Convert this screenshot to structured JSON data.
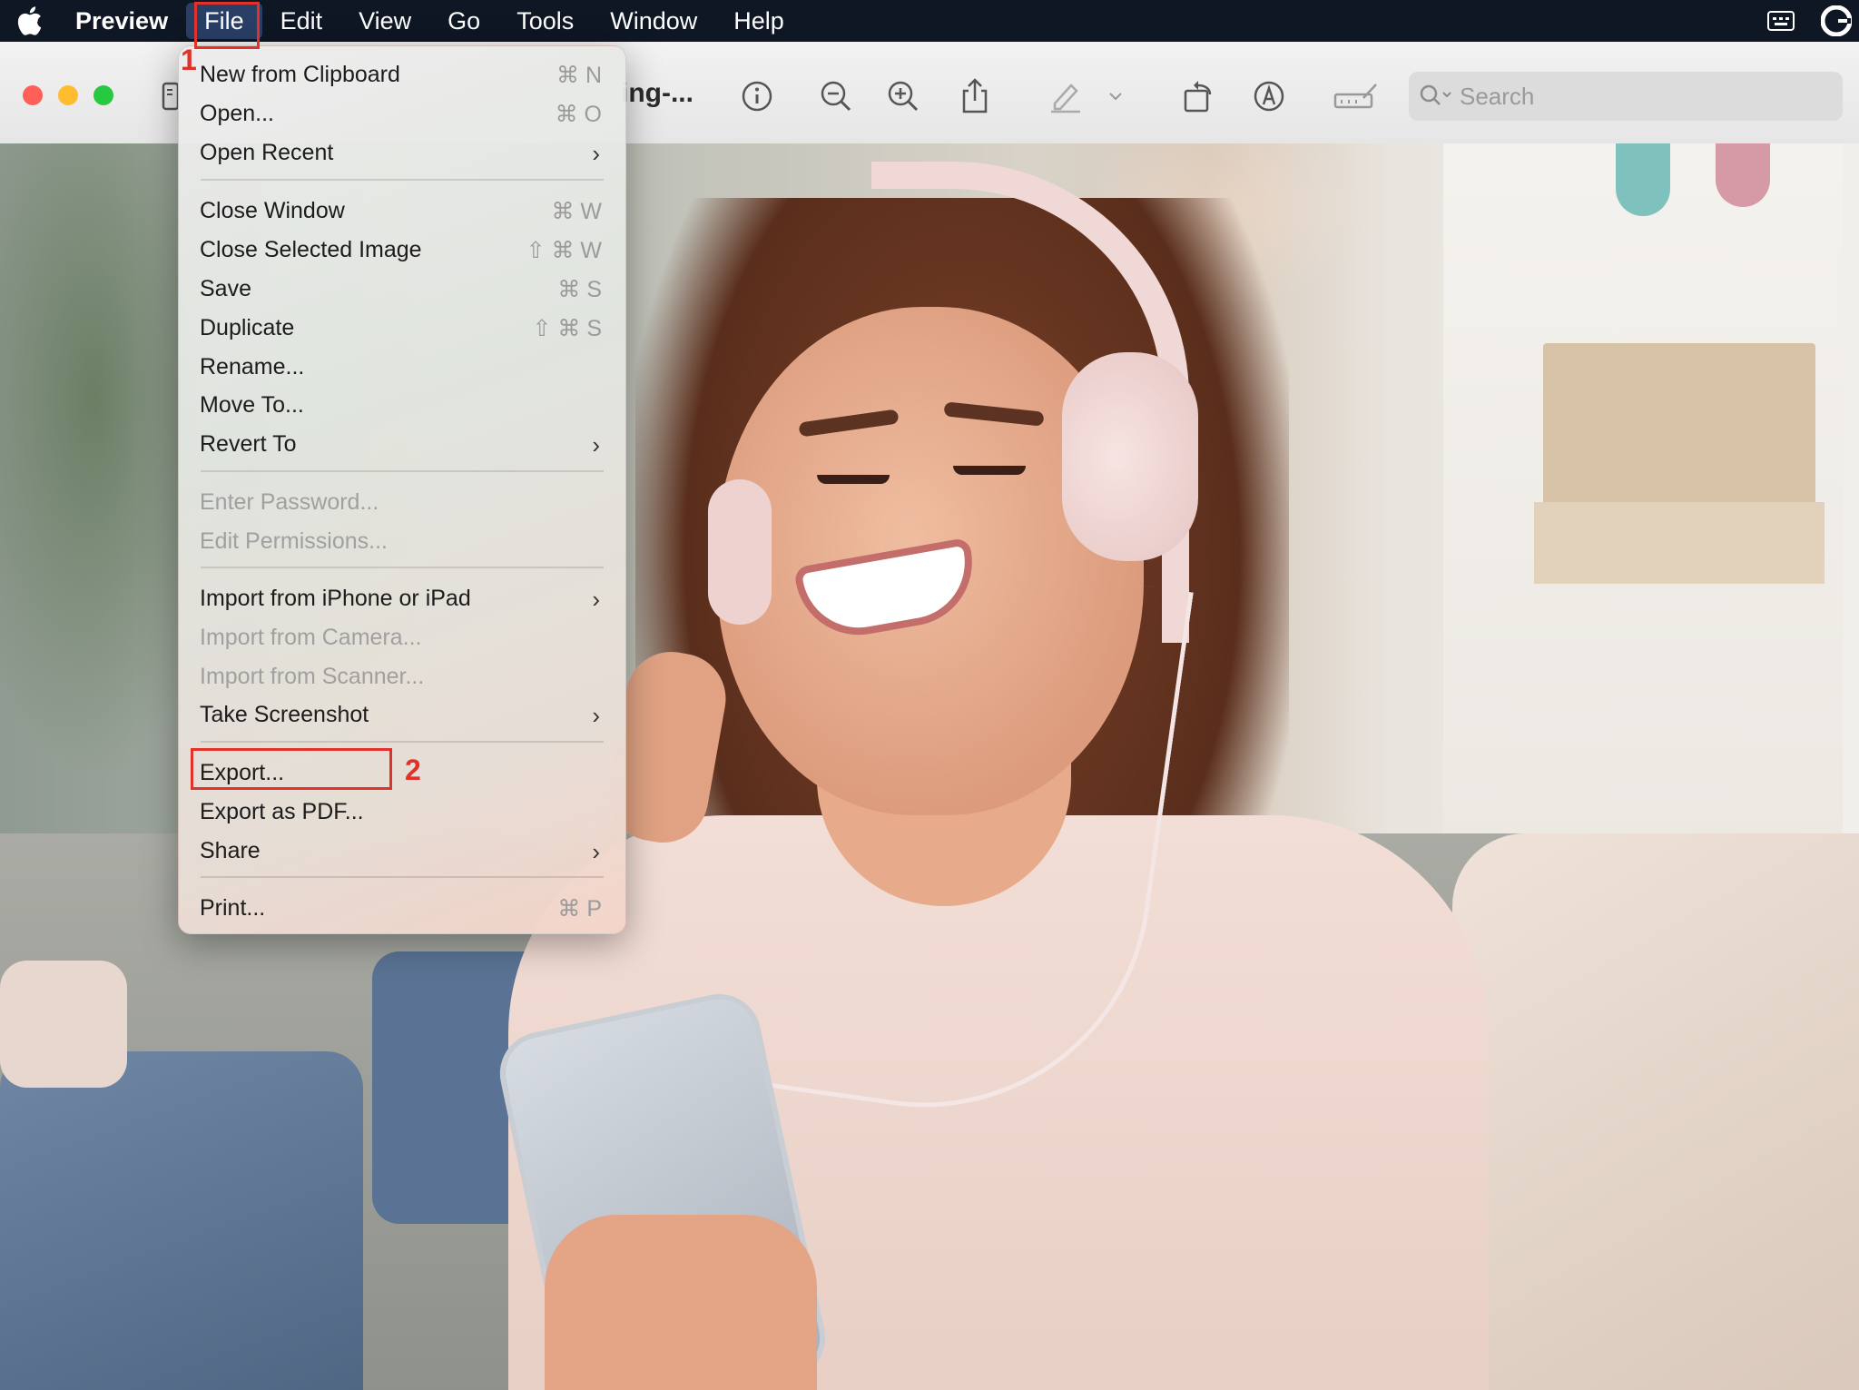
{
  "menubar": {
    "app_name": "Preview",
    "items": [
      "File",
      "Edit",
      "View",
      "Go",
      "Tools",
      "Window",
      "Help"
    ],
    "open_menu": "File",
    "right_icons": [
      "input-source-icon",
      "grammarly-icon"
    ]
  },
  "window": {
    "title": "ing-...",
    "search_placeholder": "Search",
    "toolbar_icons": [
      "info-icon",
      "zoom-out-icon",
      "zoom-in-icon",
      "share-icon",
      "highlight-icon",
      "chevron-down-icon",
      "rotate-icon",
      "markup-icon",
      "edit-toolbar-icon"
    ]
  },
  "file_menu": {
    "items": [
      {
        "label": "New from Clipboard",
        "shortcut": "⌘ N"
      },
      {
        "label": "Open...",
        "shortcut": "⌘ O"
      },
      {
        "label": "Open Recent",
        "submenu": true
      },
      {
        "label": "Close Window",
        "shortcut": "⌘ W"
      },
      {
        "label": "Close Selected Image",
        "shortcut": "⇧ ⌘ W"
      },
      {
        "label": "Save",
        "shortcut": "⌘ S"
      },
      {
        "label": "Duplicate",
        "shortcut": "⇧ ⌘ S"
      },
      {
        "label": "Rename..."
      },
      {
        "label": "Move To..."
      },
      {
        "label": "Revert To",
        "submenu": true
      },
      {
        "label": "Enter Password...",
        "disabled": true
      },
      {
        "label": "Edit Permissions...",
        "disabled": true
      },
      {
        "label": "Import from iPhone or iPad",
        "submenu": true
      },
      {
        "label": "Import from Camera...",
        "disabled": true
      },
      {
        "label": "Import from Scanner...",
        "disabled": true
      },
      {
        "label": "Take Screenshot",
        "submenu": true
      },
      {
        "label": "Export..."
      },
      {
        "label": "Export as PDF..."
      },
      {
        "label": "Share",
        "submenu": true
      },
      {
        "label": "Print...",
        "shortcut": "⌘ P"
      }
    ]
  },
  "annotations": {
    "step1": "1",
    "step2": "2",
    "color": "#e0322b"
  },
  "colors": {
    "menubar_bg": "#0f1624",
    "close": "#fe5f57",
    "minimize": "#febc2e",
    "maximize": "#28c840"
  }
}
